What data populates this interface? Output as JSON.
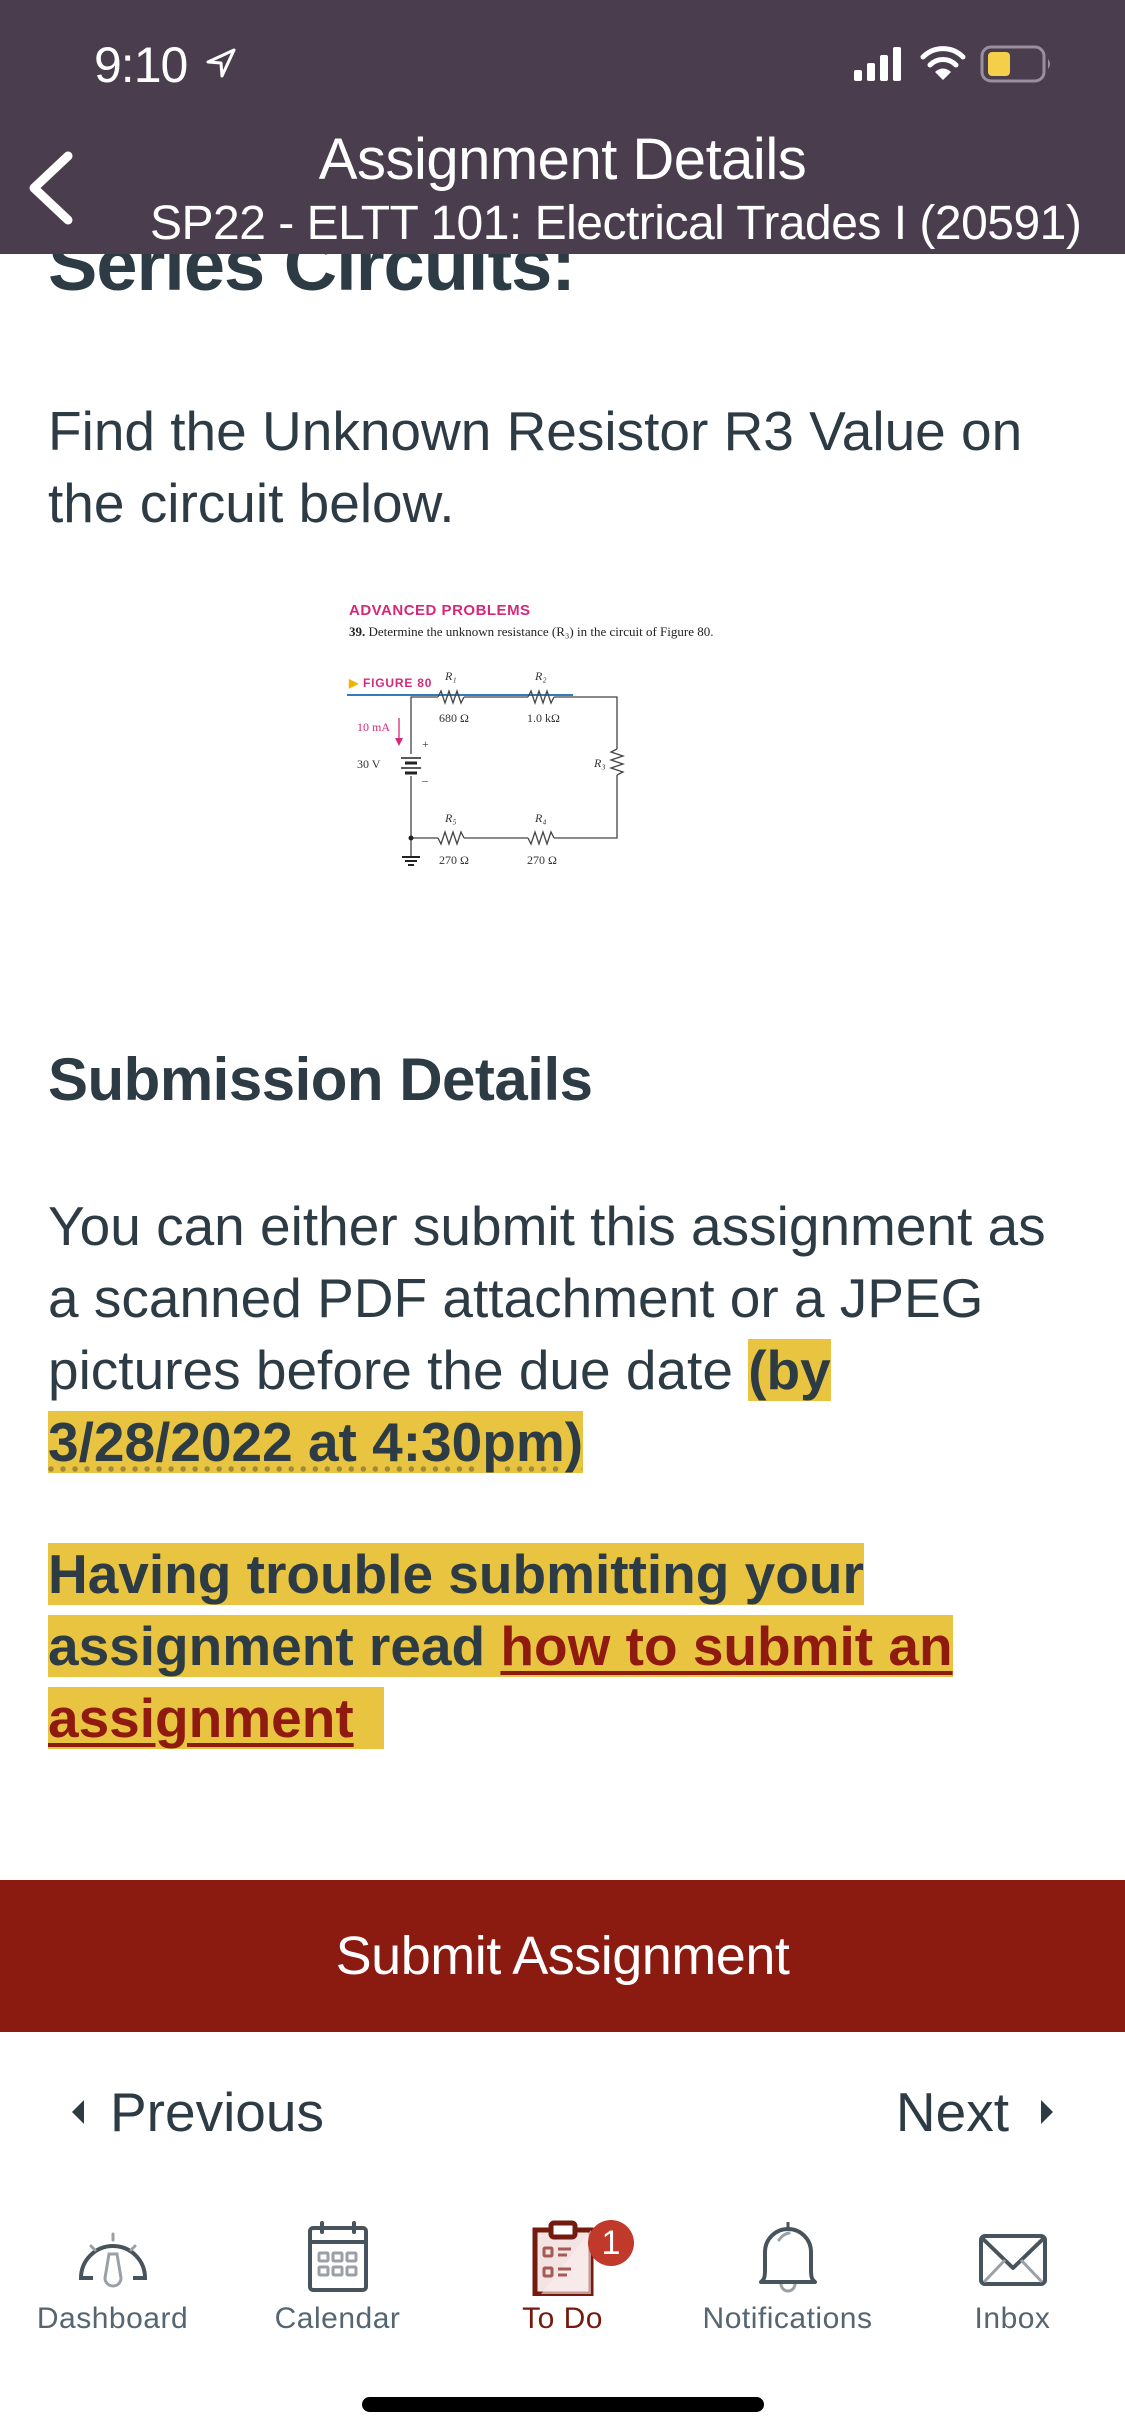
{
  "status_bar": {
    "time": "9:10",
    "location_icon": "location-arrow-icon",
    "signal_icon": "cellular-signal-icon",
    "wifi_icon": "wifi-icon",
    "battery_icon": "battery-low-icon",
    "battery_color": "#f4d04a"
  },
  "nav": {
    "back_icon": "chevron-left-icon",
    "title": "Assignment Details",
    "subtitle": "SP22 - ELTT 101: Electrical Trades I (20591)",
    "background": "#4a3d4d"
  },
  "content": {
    "section_heading": "Series Circuits:",
    "question": "Find the Unknown Resistor R3 Value on the circuit below.",
    "figure": {
      "section_label": "ADVANCED PROBLEMS",
      "problem_number": "39.",
      "problem_text": "Determine the unknown resistance (R₃) in the circuit of Figure 80.",
      "figure_label": "FIGURE 80",
      "current": "10 mA",
      "source_voltage": "30 V",
      "plus": "+",
      "minus": "–",
      "resistors": [
        {
          "name": "R₁",
          "value": "680 Ω"
        },
        {
          "name": "R₂",
          "value": "1.0 kΩ"
        },
        {
          "name": "R₃",
          "value": ""
        },
        {
          "name": "R₄",
          "value": "270 Ω"
        },
        {
          "name": "R₅",
          "value": "270 Ω"
        }
      ]
    },
    "submission": {
      "heading": "Submission Details",
      "body_text": "You can either submit this assignment as a scanned PDF attachment or a JPEG pictures before the due date ",
      "due_prefix": "(by",
      "due_date": "3/28/2022 at 4:30pm)",
      "highlight_color": "#e9c440"
    },
    "trouble": {
      "text": "Having trouble submitting your assignment read ",
      "link_text": "how to submit an assignment",
      "trailing": " ",
      "link_color": "#8f1a0f"
    }
  },
  "actions": {
    "submit_label": "Submit Assignment",
    "submit_color": "#8b1a11",
    "previous_label": "Previous",
    "next_label": "Next"
  },
  "tabbar": {
    "items": [
      {
        "label": "Dashboard",
        "icon": "dashboard-gauge-icon",
        "active": false
      },
      {
        "label": "Calendar",
        "icon": "calendar-icon",
        "active": false
      },
      {
        "label": "To Do",
        "icon": "todo-clipboard-icon",
        "active": true,
        "badge": "1"
      },
      {
        "label": "Notifications",
        "icon": "bell-icon",
        "active": false
      },
      {
        "label": "Inbox",
        "icon": "envelope-icon",
        "active": false
      }
    ],
    "active_color": "#751a0f",
    "badge_color": "#c0392b"
  }
}
